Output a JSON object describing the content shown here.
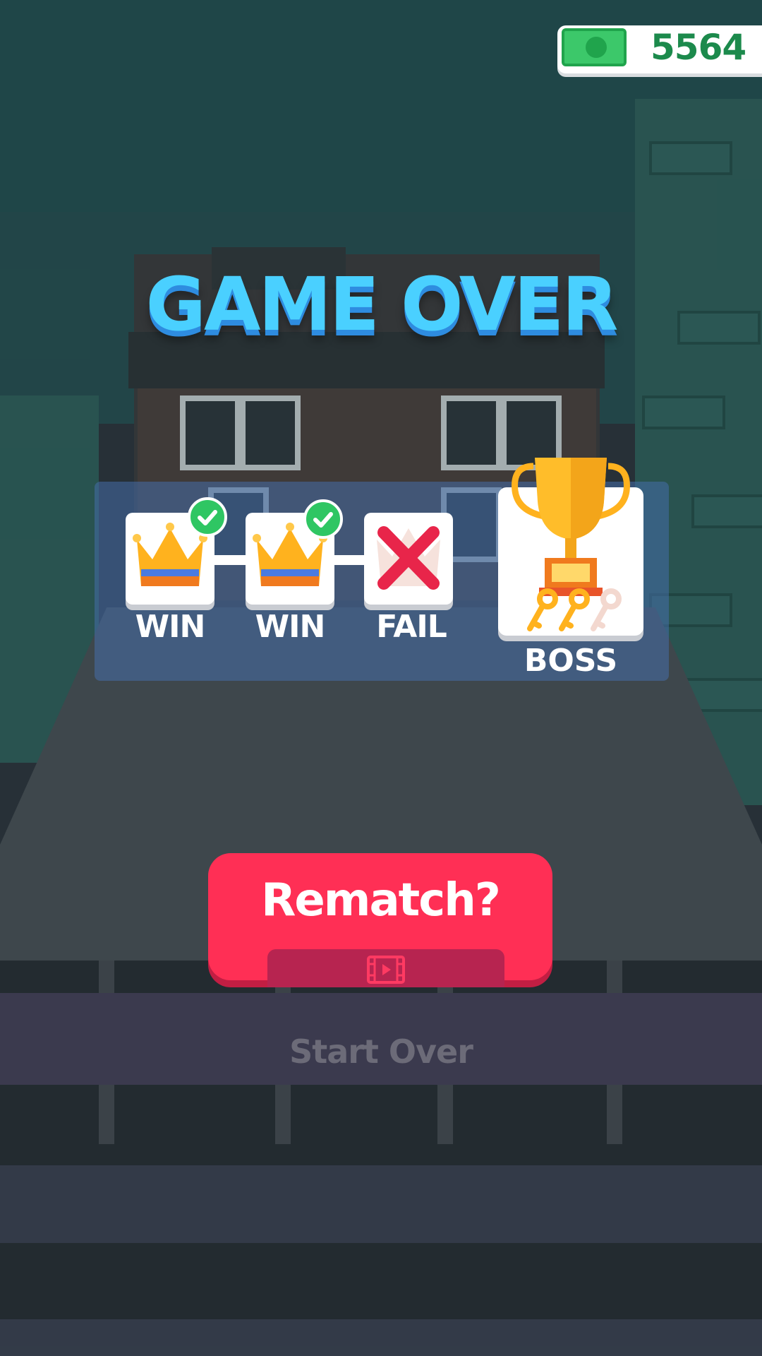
{
  "hud": {
    "cash_value": "5564",
    "cash_icon": "banknote-icon"
  },
  "title": "GAME OVER",
  "progress": {
    "stages": [
      {
        "label": "WIN",
        "icon": "crown-icon",
        "status": "completed"
      },
      {
        "label": "WIN",
        "icon": "crown-icon",
        "status": "completed"
      },
      {
        "label": "FAIL",
        "icon": "cross-icon",
        "status": "failed"
      }
    ],
    "boss": {
      "label": "BOSS",
      "icon": "trophy-icon",
      "keys_collected": 2,
      "keys_total": 3
    }
  },
  "buttons": {
    "rematch_label": "Rematch?",
    "rematch_icon": "video-ad-icon",
    "start_over_label": "Start Over"
  },
  "colors": {
    "title": "#4ad0ff",
    "rematch": "#ff2f55",
    "check": "#2fc663",
    "cross": "#e8254a",
    "crown": "#ffb21e",
    "cash_text": "#1c8a4c"
  }
}
